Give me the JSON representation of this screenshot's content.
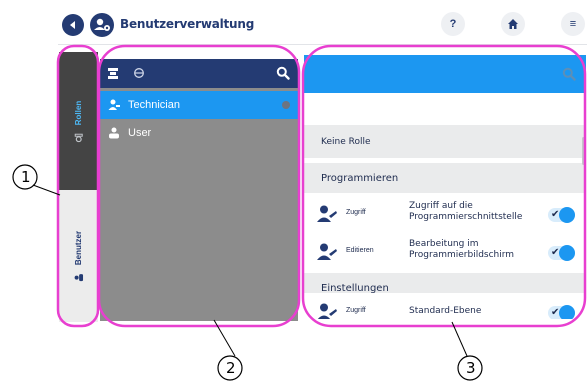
{
  "header": {
    "title": "Benutzerverwaltung",
    "help_label": "?",
    "menu_label": "≡"
  },
  "side_tabs": {
    "roles_label": "Rollen",
    "users_label": "Benutzer"
  },
  "roles_list": {
    "items": [
      {
        "label": "Technician",
        "selected": true
      },
      {
        "label": "User",
        "selected": false
      }
    ]
  },
  "permissions": {
    "no_role_label": "Keine Rolle",
    "sections": [
      {
        "title": "Programmieren",
        "items": [
          {
            "kind": "Zugriff",
            "line1": "Zugriff auf die",
            "line2": "Programmierschnittstelle",
            "enabled": true
          },
          {
            "kind": "Editieren",
            "line1": "Bearbeitung im",
            "line2": "Programmierbildschirm",
            "enabled": true
          }
        ]
      },
      {
        "title": "Einstellungen",
        "items": [
          {
            "kind": "Zugriff",
            "line1": "Standard-Ebene",
            "line2": "",
            "enabled": true
          }
        ]
      }
    ]
  },
  "callouts": [
    "1",
    "2",
    "3"
  ],
  "colors": {
    "navy": "#243b73",
    "accent_blue": "#1c97f1",
    "tab_active": "#444444",
    "list_bg": "#8c8c8c",
    "section_bg": "#eaebec",
    "callout_magenta": "#e83fd0"
  }
}
